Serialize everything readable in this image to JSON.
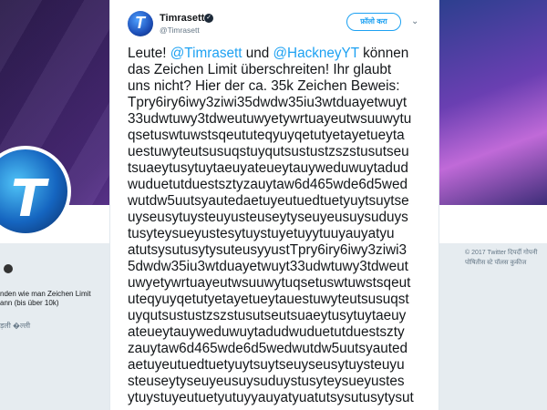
{
  "tweet": {
    "author_name": "Timrasett",
    "author_handle": "@Timrasett",
    "follow_label": "फ़ॉलो करा",
    "verified_icon": "check-icon",
    "lines": [
      [
        "Leute! ",
        "@Timrasett",
        " und ",
        "@HackneyYT",
        " können"
      ],
      [
        "das Zeichen Limit überschreiten! Ihr glaubt"
      ],
      [
        "uns nicht? Hier der ca. 35k Zeichen Beweis:"
      ],
      [
        "Tpry6iry6iwy3ziwi35dwdw35iu3wtduayetwuyt"
      ],
      [
        "33udwtuwy3tdweutuwyetywrtuayeutwsuuwytu"
      ],
      [
        "qsetuswtuwstsqeututeqyuyqetutyetayetueyta"
      ],
      [
        "uestuwyteutsusuqstuyqutsustustzszstusutseu"
      ],
      [
        "tsuaeytusytuytaeuyateueytauyweduwuytadud"
      ],
      [
        "wuduetutduestsztyzauytaw6d465wde6d5wed"
      ],
      [
        "wutdw5uutsyautedaetuyeutuedtuetyuytsuytse"
      ],
      [
        "uyseusytuysteuyusteuseytyseuyeusuysuduys"
      ],
      [
        "tusyteysueyustesytuystuyetuyytuuyauyatyu"
      ],
      [
        "atutsysutusytysuteusyyustTpry6iry6iwy3ziwi3"
      ],
      [
        "5dwdw35iu3wtduayetwuyt33udwtuwy3tdweut"
      ],
      [
        "uwyetywrtuayeutwsuuwytuqsetuswtuwstsqeut"
      ],
      [
        "uteqyuyqetutyetayetueytauestuwyteutsusuqst"
      ],
      [
        "uyqutsustustzszstusutseutsuaeytusytuytaeuy"
      ],
      [
        "ateueytauyweduwuytadudwuduetutduestszty"
      ],
      [
        "zauytaw6d465wde6d5wedwutdw5uutsyauted"
      ],
      [
        "aetuyeutuedtuetyuytsuytseuyseusytuysteuyu"
      ],
      [
        "steuseytyseuyeusuysuduystusyteysueyustes"
      ],
      [
        "ytuystuyeutuetyutuyyauyatyuatutsysutusytysut"
      ]
    ]
  },
  "profile": {
    "bio_line1": "nden wie man Zeichen Limit",
    "bio_line2": "ann (bis über 10k)",
    "bio_meta": "ड़ली �ल्ली"
  },
  "footer": {
    "line1": "© 2017 Twitter   दिपर्दी   गोपनी",
    "line2": "पोषितीस स्टे पॉलस  कुकीज"
  }
}
